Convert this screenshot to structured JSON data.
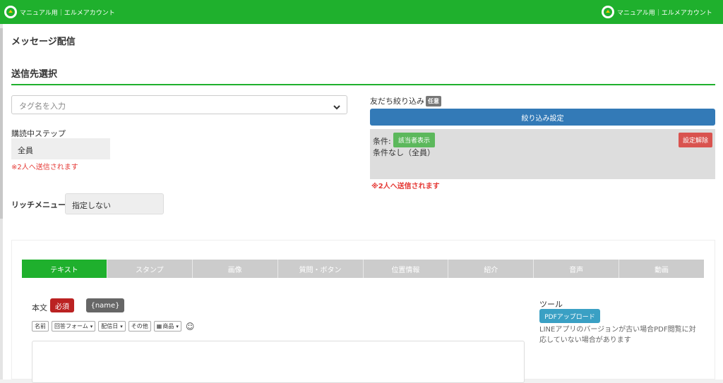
{
  "header": {
    "brand_text_left": "マニュアル用｜エルメアカウント",
    "brand_text_right": "マニュアル用｜エルメアカウント",
    "brand_color": "#1fb02d"
  },
  "page": {
    "title": "メッセージ配信",
    "section_title": "送信先選択"
  },
  "recipient": {
    "tag_placeholder": "タグ名を入力",
    "step_label": "購読中ステップ",
    "step_value": "全員",
    "step_warning": "※2人へ送信されます",
    "rich_menu_label": "リッチメニュー",
    "rich_menu_value": "指定しない"
  },
  "filter": {
    "label": "友だち絞り込み",
    "optional_badge": "任意",
    "settings_button": "絞り込み設定",
    "condition_label": "条件:",
    "show_button": "該当者表示",
    "clear_button": "設定解除",
    "condition_text": "条件なし（全員）",
    "warning": "※2人へ送信されます"
  },
  "editor": {
    "tabs": [
      {
        "label": "テキスト",
        "active": true
      },
      {
        "label": "スタンプ",
        "active": false
      },
      {
        "label": "画像",
        "active": false
      },
      {
        "label": "質問・ボタン",
        "active": false
      },
      {
        "label": "位置情報",
        "active": false
      },
      {
        "label": "紹介",
        "active": false
      },
      {
        "label": "音声",
        "active": false
      },
      {
        "label": "動画",
        "active": false
      }
    ],
    "body_label": "本文",
    "required_badge": "必須",
    "name_chip": "{name}",
    "toolbar": {
      "name": "名前",
      "form": "回答フォーム",
      "date": "配信日",
      "other": "その他",
      "product": "商品",
      "emoji_icon": "smiley-icon"
    },
    "tools_label": "ツール",
    "pdf_button": "PDFアップロード",
    "pdf_note": "LINEアプリのバージョンが古い場合PDF閲覧に対応していない場合があります"
  }
}
